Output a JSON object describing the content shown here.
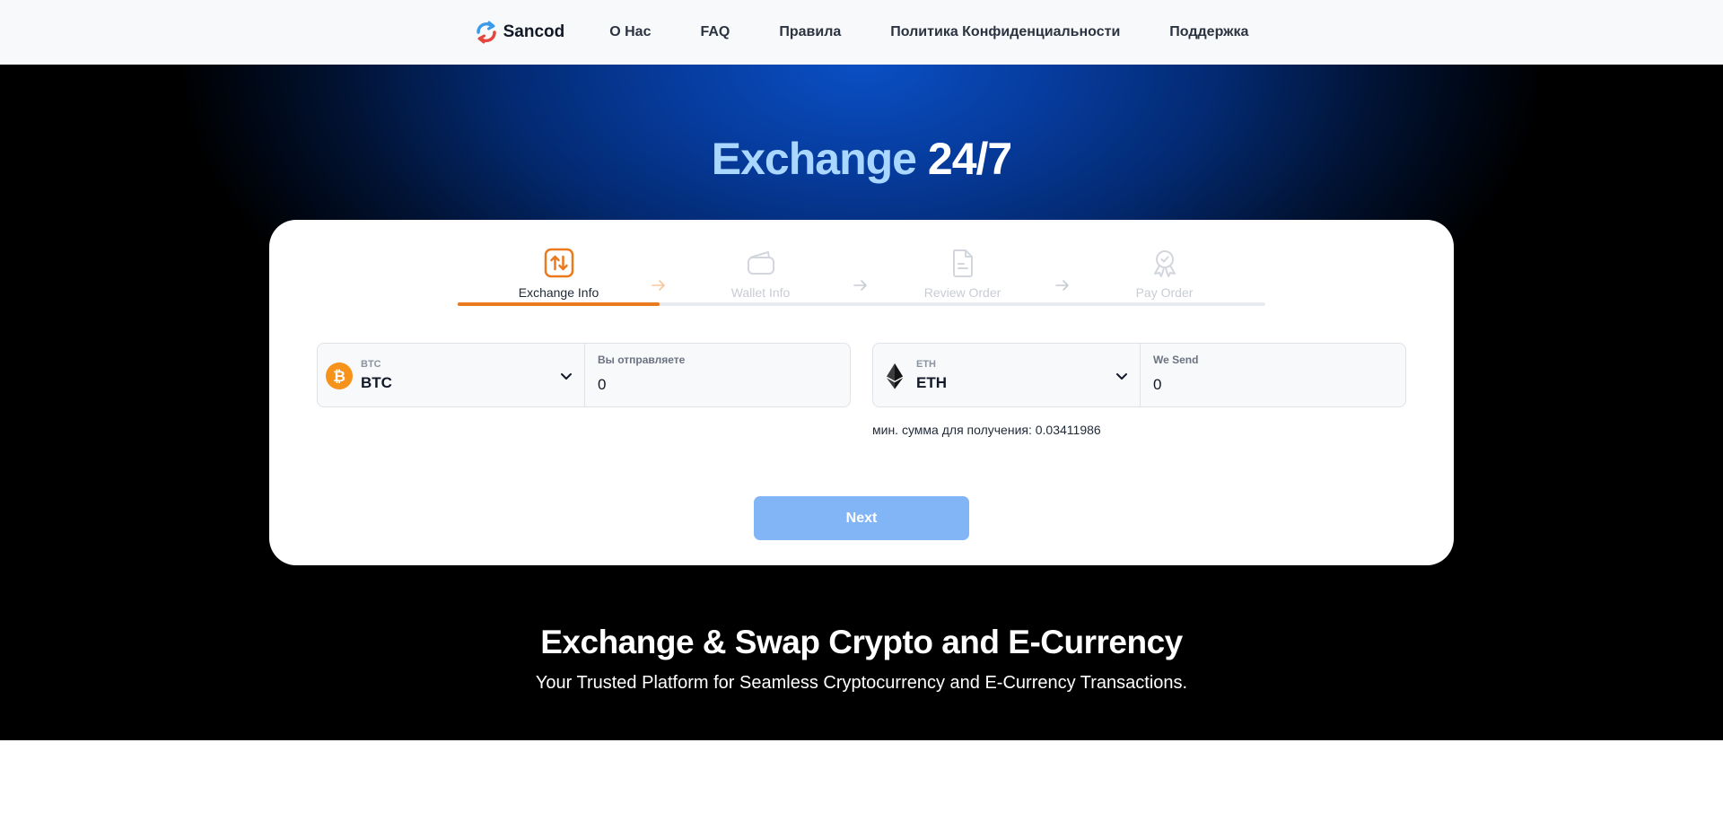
{
  "nav": {
    "brand": "Sancod",
    "links": [
      "О Нас",
      "FAQ",
      "Правила",
      "Политика Конфиденциальности",
      "Поддержка"
    ]
  },
  "hero": {
    "title_part1": "Exchange",
    "title_part2": "24/7"
  },
  "steps": [
    {
      "label": "Exchange Info",
      "icon": "exchange-icon",
      "active": true
    },
    {
      "label": "Wallet Info",
      "icon": "wallet-icon",
      "active": false
    },
    {
      "label": "Review Order",
      "icon": "document-icon",
      "active": false
    },
    {
      "label": "Pay Order",
      "icon": "badge-icon",
      "active": false
    }
  ],
  "progress": 0.25,
  "send": {
    "coin_small": "BTC",
    "coin_big": "BTC",
    "amount_label": "Вы отправляете",
    "amount_value": "0"
  },
  "receive": {
    "coin_small": "ETH",
    "coin_big": "ETH",
    "amount_label": "We Send",
    "amount_value": "0"
  },
  "min_note": "мин. сумма для получения: 0.03411986",
  "next_label": "Next",
  "tagline": {
    "title": "Exchange & Swap Crypto and E-Currency",
    "subtitle": "Your Trusted Platform for Seamless Cryptocurrency and E-Currency Transactions."
  },
  "colors": {
    "accent": "#ea7a1e",
    "button": "#82b5f5",
    "hero_highlight": "#a9d7ff"
  }
}
